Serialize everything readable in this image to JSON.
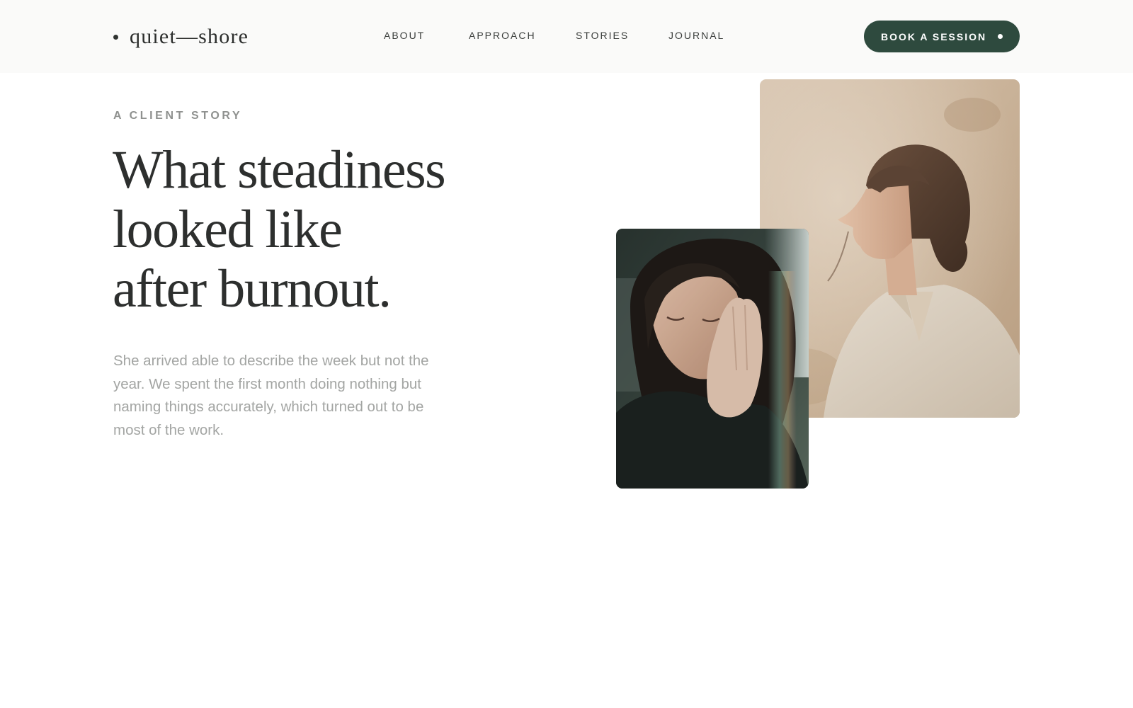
{
  "header": {
    "brand": {
      "name": "quiet—shore",
      "icon": "brand-dot-icon"
    },
    "nav": [
      {
        "label": "ABOUT"
      },
      {
        "label": "APPROACH"
      },
      {
        "label": "STORIES"
      },
      {
        "label": "JOURNAL"
      }
    ],
    "cta": {
      "label": "BOOK A SESSION",
      "icon": "dot-icon"
    }
  },
  "hero": {
    "eyebrow": "A CLIENT STORY",
    "headline_lines": [
      "What steadiness",
      "looked like",
      "after burnout."
    ],
    "lede": "She arrived able to describe the week but not the year. We spent the first month doing nothing but naming things accurately, which turned out to be most of the work."
  },
  "colors": {
    "accent": "#2e4a3e",
    "heading": "#2d2f2e",
    "muted": "#a3a5a3",
    "eyebrow": "#8f918f",
    "header_bg": "#fafaf9"
  }
}
